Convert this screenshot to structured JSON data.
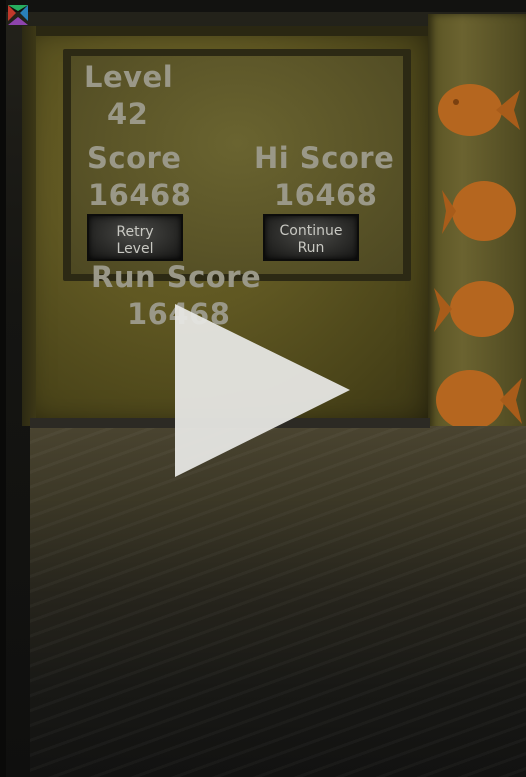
{
  "hud": {
    "level_label": "Level",
    "level_value": "42",
    "score_label": "Score",
    "score_value": "16468",
    "hi_score_label": "Hi Score",
    "hi_score_value": "16468",
    "run_score_label": "Run Score",
    "run_score_value": "16468"
  },
  "buttons": {
    "retry_line1": "Retry",
    "retry_line2": "Level",
    "continue_line1": "Continue",
    "continue_line2": "Run"
  },
  "icons": {
    "play": "play-icon",
    "fish": "fish-cracker-icon",
    "logo": "app-logo-icon"
  },
  "colors": {
    "wall": "#5f5722",
    "text": "#9a9888",
    "button": "#2a2a28",
    "fish": "#b5661f"
  }
}
